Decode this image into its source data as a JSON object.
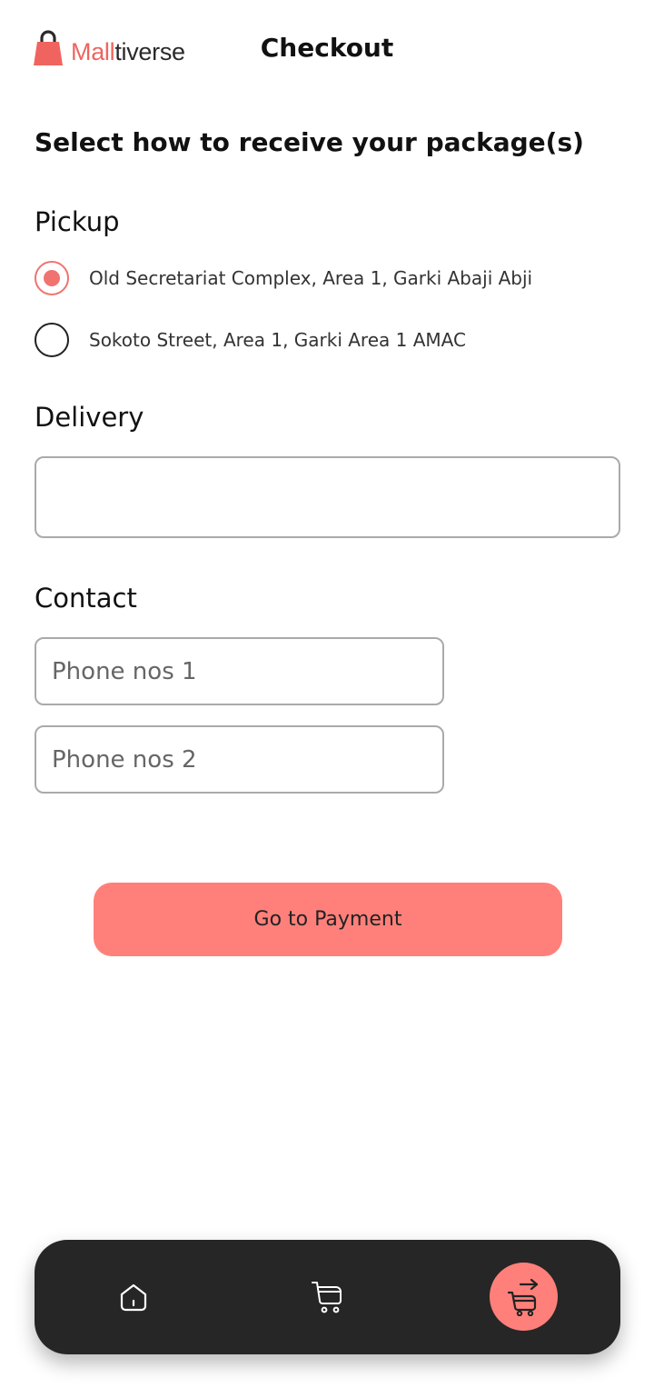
{
  "header": {
    "logo": {
      "part_highlight": "Mall",
      "part_rest": "tiverse",
      "icon": "shopping-bag-icon",
      "brand_color": "#f0645f"
    },
    "title": "Checkout"
  },
  "main": {
    "prompt": "Select how to receive your package(s)",
    "pickup": {
      "heading": "Pickup",
      "selected_index": 0,
      "options": [
        {
          "label": "Old Secretariat Complex, Area 1, Garki Abaji Abji",
          "selected": true
        },
        {
          "label": "Sokoto Street, Area 1, Garki Area 1 AMAC",
          "selected": false
        }
      ]
    },
    "delivery": {
      "heading": "Delivery",
      "value": "",
      "placeholder": ""
    },
    "contact": {
      "heading": "Contact",
      "phone1": {
        "placeholder": "Phone nos 1",
        "value": ""
      },
      "phone2": {
        "placeholder": "Phone nos 2",
        "value": ""
      }
    },
    "submit_button": "Go to Payment"
  },
  "bottom_nav": {
    "items": [
      {
        "icon": "home-icon",
        "active": false
      },
      {
        "icon": "cart-icon",
        "active": false
      },
      {
        "icon": "cart-checkout-icon",
        "active": true
      }
    ]
  },
  "colors": {
    "accent": "#ff807a",
    "radio_selected": "#f0736f",
    "nav_background": "#262626",
    "input_border": "#aaaaaa"
  }
}
